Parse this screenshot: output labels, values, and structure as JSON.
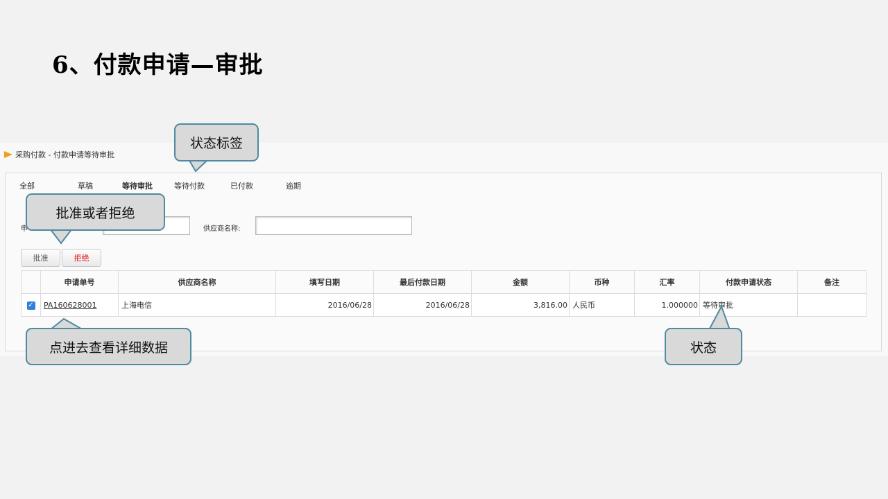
{
  "slide": {
    "title": "6、付款申请—审批"
  },
  "breadcrumb": {
    "text": "采购付款 - 付款申请等待审批"
  },
  "tabs": [
    "全部",
    "草稿",
    "等待审批",
    "等待付款",
    "已付款",
    "逾期"
  ],
  "filters": {
    "apply_no_label": "申",
    "supplier_label": "供应商名称:",
    "apply_no_value": "",
    "supplier_value": ""
  },
  "actions": {
    "approve": "批准",
    "reject": "拒绝"
  },
  "table": {
    "headers": [
      "申请单号",
      "供应商名称",
      "填写日期",
      "最后付款日期",
      "金额",
      "币种",
      "汇率",
      "付款申请状态",
      "备注"
    ],
    "rows": [
      {
        "checked": true,
        "apply_no": "PA160628001",
        "supplier": "上海电信",
        "fill_date": "2016/06/28",
        "last_pay_date": "2016/06/28",
        "amount": "3,816.00",
        "currency": "人民币",
        "rate": "1.000000",
        "status": "等待审批",
        "remark": ""
      }
    ]
  },
  "callouts": {
    "status_tabs": "状态标签",
    "approve_reject": "批准或者拒绝",
    "view_detail": "点进去查看详细数据",
    "status": "状态"
  },
  "colors": {
    "callout_border": "#4e8aa0",
    "callout_fill": "#d9d9d9",
    "reject_text": "#e01010",
    "breadcrumb_arrow": "#f0a020"
  }
}
